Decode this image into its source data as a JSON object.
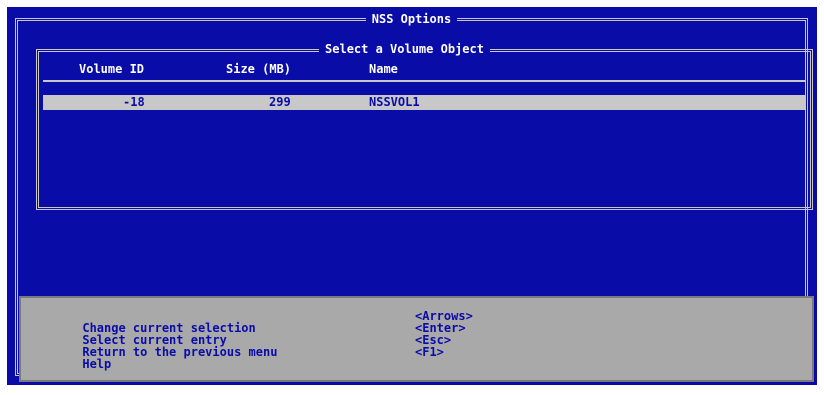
{
  "window": {
    "title": "NSS Options"
  },
  "volume_list": {
    "title": "Select a Volume Object",
    "columns": [
      "Volume ID",
      "Size (MB)",
      "Name"
    ],
    "rows": [
      {
        "id": "-18",
        "size": "299",
        "name": "NSSVOL1",
        "selected": true
      }
    ]
  },
  "help": {
    "items": [
      {
        "action": "Change current selection",
        "key": "<Arrows>"
      },
      {
        "action": "Select current entry",
        "key": "<Enter>"
      },
      {
        "action": "Return to the previous menu",
        "key": "<Esc>"
      },
      {
        "action": "Help",
        "key": "<F1>"
      }
    ]
  },
  "colors": {
    "background": "#0a0ca8",
    "highlight": "#c8c8c8",
    "help_panel": "#a9a9a9",
    "text": "#ffffff"
  }
}
